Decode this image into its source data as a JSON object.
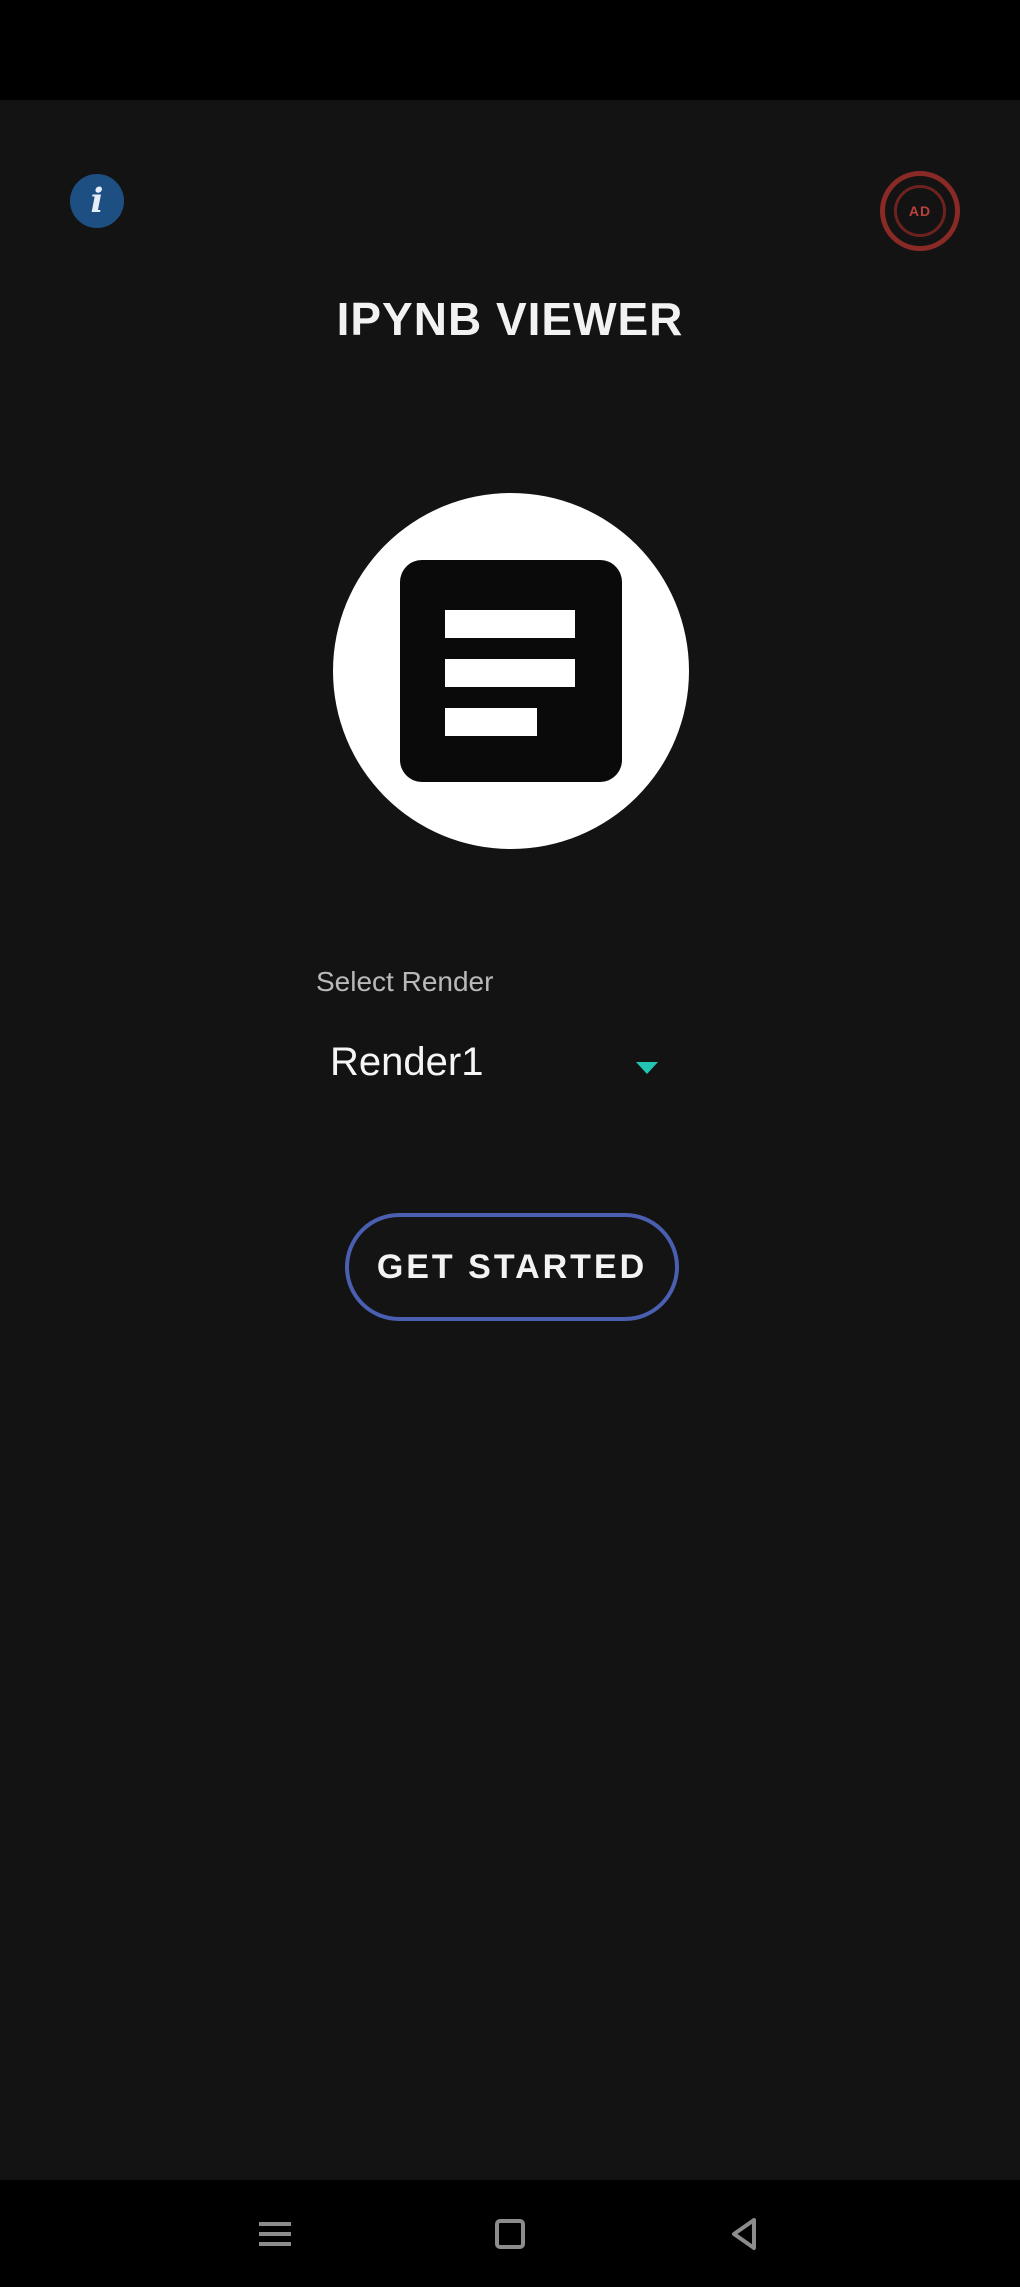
{
  "app": {
    "title": "IPYNB VIEWER"
  },
  "header": {
    "info_icon": "info-icon",
    "info_glyph": "i",
    "ad_icon": "ad-icon",
    "ad_glyph": "AD"
  },
  "logo": {
    "icon": "notes-document-icon"
  },
  "render_select": {
    "label": "Select Render",
    "selected": "Render1",
    "caret_icon": "caret-down-icon"
  },
  "actions": {
    "get_started_label": "GET STARTED"
  },
  "nav": {
    "recent_icon": "recent-apps-icon",
    "home_icon": "home-icon",
    "back_icon": "back-icon"
  },
  "colors": {
    "background": "#131313",
    "info_button": "#1e4f82",
    "ad_ring": "#8a2a26",
    "caret": "#23c4b4",
    "button_border": "#4a5fb0"
  }
}
